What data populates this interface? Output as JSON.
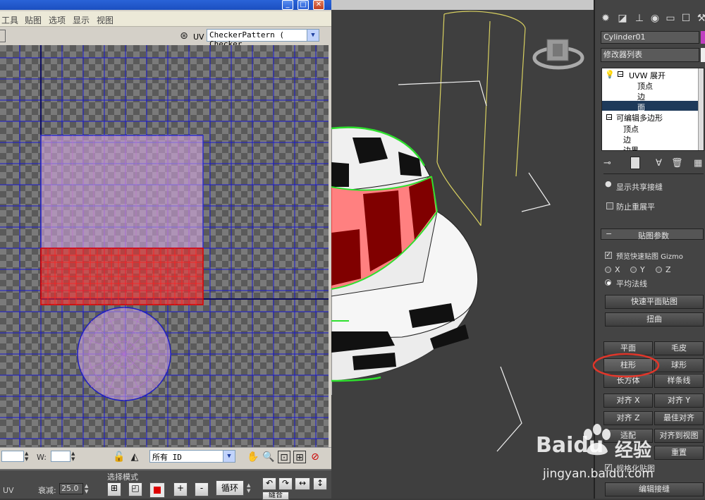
{
  "uv_editor": {
    "menus": [
      "工具",
      "贴图",
      "选项",
      "显示",
      "视图"
    ],
    "window_buttons": [
      "_",
      "□",
      "✕"
    ],
    "uv_label": "UV",
    "map_select": "CheckerPattern  ( Checker",
    "w_label": "W:",
    "id_select": "所有 ID",
    "bottom": {
      "uv_label": "UV",
      "falloff_label": "衰减:",
      "falloff_value": "25.0",
      "select_mode_label": "选择模式",
      "plus": "+",
      "minus": "-",
      "loop_label": "循环",
      "cut_label": "缝合"
    }
  },
  "command_panel": {
    "object_name": "Cylinder01",
    "modifier_list": "修改器列表",
    "stack_items": [
      "UVW 展开",
      "顶点",
      "边",
      "面",
      "可编辑多边形",
      "顶点",
      "边",
      "边界"
    ],
    "stack_selected_index": 3,
    "show_shared_seams": "显示共享接缝",
    "prevent_reflatten": "防止重展平",
    "map_params_title": "贴图参数",
    "preview_gizmo": "预览快速贴图 Gizmo",
    "axis_x": "X",
    "axis_y": "Y",
    "axis_z": "Z",
    "avg_normals": "平均法线",
    "quick_planar": "快速平面贴图",
    "twist": "扭曲",
    "planar": "平面",
    "pelt": "毛皮",
    "cylindrical": "柱形",
    "spherical": "球形",
    "box": "长方体",
    "spline": "样条线",
    "align_x": "对齐 X",
    "align_y": "对齐 Y",
    "align_z": "对齐 Z",
    "best_align": "最佳对齐",
    "fit": "适配",
    "align_to_view": "对齐到视图",
    "reset": "重置",
    "normalize_map": "规格化贴图",
    "edit_seams": "编辑接缝",
    "highlight_color": "#e0362a"
  },
  "watermark": {
    "brand": "Baidu",
    "brand_cn": "经验",
    "url": "jingyan.baidu.com"
  }
}
